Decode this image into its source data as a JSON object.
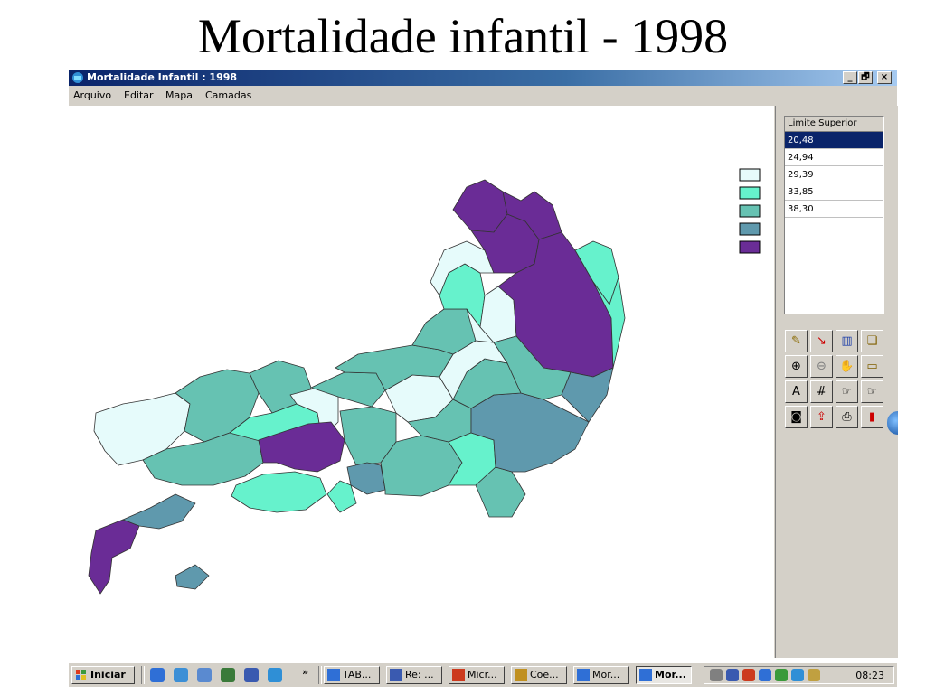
{
  "slide": {
    "title": "Mortalidade infantil - 1998"
  },
  "window": {
    "title": "Mortalidade Infantil : 1998",
    "controls": {
      "minimize": "_",
      "restore": "🗗",
      "close": "×"
    },
    "menu": [
      "Arquivo",
      "Editar",
      "Mapa",
      "Camadas"
    ]
  },
  "legend": {
    "header": "Limite Superior",
    "classes": [
      {
        "value": "20,48",
        "color": "#e6fbfb",
        "selected": true
      },
      {
        "value": "24,94",
        "color": "#66f2cc",
        "selected": false
      },
      {
        "value": "29,39",
        "color": "#66c2b2",
        "selected": false
      },
      {
        "value": "33,85",
        "color": "#5f99ad",
        "selected": false
      },
      {
        "value": "38,30",
        "color": "#6a2c96",
        "selected": false
      }
    ]
  },
  "toolbar": {
    "tools": [
      {
        "name": "pencil-icon",
        "glyph": "✎",
        "color": "#8a6a00"
      },
      {
        "name": "curve-icon",
        "glyph": "↘",
        "color": "#cc0000"
      },
      {
        "name": "chart-icon",
        "glyph": "▥",
        "color": "#1e3fa8"
      },
      {
        "name": "layers-icon",
        "glyph": "❏",
        "color": "#806000"
      },
      {
        "name": "zoom-in-icon",
        "glyph": "⊕",
        "color": "#000000"
      },
      {
        "name": "zoom-out-icon",
        "glyph": "⊖",
        "color": "#808080"
      },
      {
        "name": "hand-icon",
        "glyph": "✋",
        "color": "#808080"
      },
      {
        "name": "folder-open-icon",
        "glyph": "▭",
        "color": "#806000"
      },
      {
        "name": "text-icon",
        "glyph": "A",
        "color": "#000000"
      },
      {
        "name": "grid-icon",
        "glyph": "#",
        "color": "#000000"
      },
      {
        "name": "pointer-icon",
        "glyph": "☞",
        "color": "#000000"
      },
      {
        "name": "pointer-select-icon",
        "glyph": "☞",
        "color": "#000000"
      },
      {
        "name": "camera-icon",
        "glyph": "◙",
        "color": "#000000"
      },
      {
        "name": "export-icon",
        "glyph": "⇪",
        "color": "#cc0000"
      },
      {
        "name": "print-icon",
        "glyph": "⎙",
        "color": "#000000"
      },
      {
        "name": "book-icon",
        "glyph": "▮",
        "color": "#cc0000"
      }
    ]
  },
  "taskbar": {
    "start_label": "Iniciar",
    "overflow": "»",
    "quick_launch": [
      {
        "name": "ie-icon",
        "color": "#2f6fd6"
      },
      {
        "name": "outlook-icon",
        "color": "#3c8fd6"
      },
      {
        "name": "search-icon",
        "color": "#5a8ad0"
      },
      {
        "name": "notepad-icon",
        "color": "#3a7a3a"
      },
      {
        "name": "app-icon",
        "color": "#3a5ab0"
      },
      {
        "name": "browser-icon",
        "color": "#2f8fd6"
      }
    ],
    "tasks": [
      {
        "label": "TAB...",
        "icon": "magnifier-icon",
        "color": "#2f6fd6",
        "active": false
      },
      {
        "label": "Re: ...",
        "icon": "arrow-icon",
        "color": "#3a5ab0",
        "active": false
      },
      {
        "label": "Micr...",
        "icon": "powerpoint-icon",
        "color": "#cc3a1e",
        "active": false
      },
      {
        "label": "Coe...",
        "icon": "grid-app-icon",
        "color": "#c09020",
        "active": false
      },
      {
        "label": "Mor...",
        "icon": "map-app-icon",
        "color": "#2f6fd6",
        "active": false
      },
      {
        "label": "Mor...",
        "icon": "map-app-icon",
        "color": "#2f6fd6",
        "active": true
      }
    ],
    "tray_icons": [
      {
        "name": "speaker-icon",
        "color": "#808080"
      },
      {
        "name": "network-icon",
        "color": "#3a5ab0"
      },
      {
        "name": "shield-icon",
        "color": "#cc3a1e"
      },
      {
        "name": "monitor-icon",
        "color": "#2f6fd6"
      },
      {
        "name": "antivirus-icon",
        "color": "#3a9a3a"
      },
      {
        "name": "globe-icon",
        "color": "#2f8fd6"
      },
      {
        "name": "connection-icon",
        "color": "#c0a040"
      }
    ],
    "clock": "08:23"
  }
}
